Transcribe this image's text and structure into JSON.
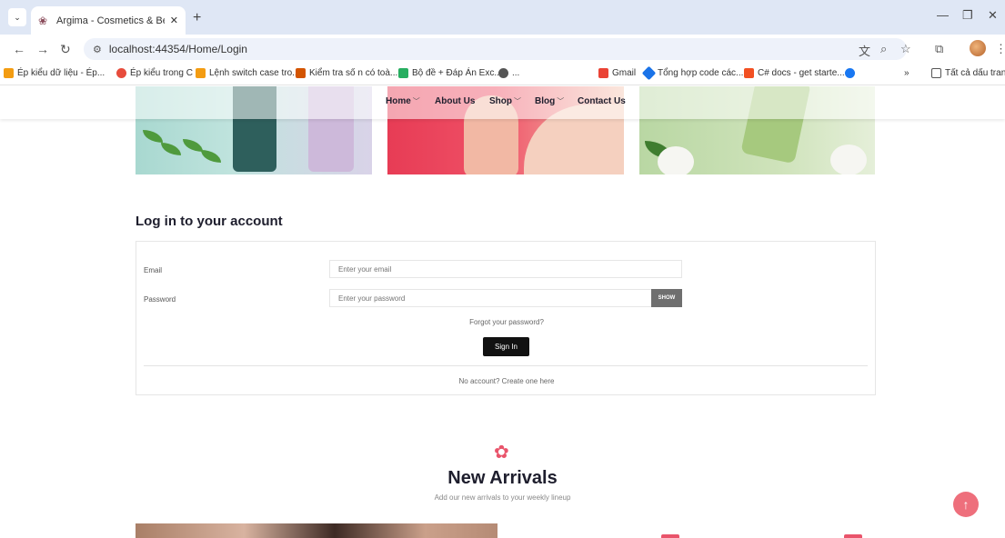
{
  "browser": {
    "tab_title": "Argima - Cosmetics & Beauty e",
    "url": "localhost:44354/Home/Login",
    "new_tab": "+",
    "bookmarks": [
      {
        "label": "Ép kiểu dữ liệu - Ép...",
        "color": "#f39c12"
      },
      {
        "label": "Ép kiểu trong C",
        "color": "#e74c3c"
      },
      {
        "label": "Lệnh switch case tro...",
        "color": "#f39c12"
      },
      {
        "label": "Kiểm tra số n có toà...",
        "color": "#d35400"
      },
      {
        "label": "Bộ đề + Đáp Án Exc...",
        "color": "#27ae60"
      },
      {
        "label": "...",
        "color": "#555555"
      },
      {
        "label": "Gmail",
        "color": "#ea4335"
      },
      {
        "label": "Tổng hợp code các...",
        "color": "#1a73e8"
      },
      {
        "label": "C# docs - get starte...",
        "color": "#f25022"
      },
      {
        "label": "",
        "color": "#1877f2"
      }
    ],
    "bookmarks_more": "»",
    "all_bookmarks": "Tất cả dấu trang"
  },
  "nav": {
    "items": [
      {
        "label": "Home",
        "has_dropdown": true
      },
      {
        "label": "About Us",
        "has_dropdown": false
      },
      {
        "label": "Shop",
        "has_dropdown": true
      },
      {
        "label": "Blog",
        "has_dropdown": true
      },
      {
        "label": "Contact Us",
        "has_dropdown": false
      }
    ]
  },
  "login": {
    "title": "Log in to your account",
    "email_label": "Email",
    "email_placeholder": "Enter your email",
    "password_label": "Password",
    "password_placeholder": "Enter your password",
    "show_label": "SHOW",
    "forgot": "Forgot your password?",
    "signin": "Sign In",
    "create": "No account? Create one here"
  },
  "new_arrivals": {
    "title": "New Arrivals",
    "subtitle": "Add our new arrivals to your weekly lineup"
  },
  "colors": {
    "accent": "#e9546b",
    "dark": "#1e1e2d"
  }
}
